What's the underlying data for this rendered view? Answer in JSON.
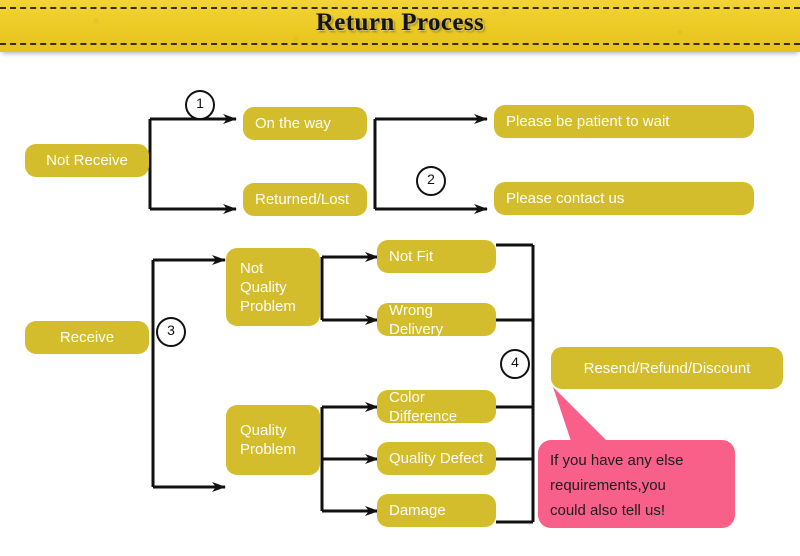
{
  "banner": {
    "title": "Return Process",
    "background_color": "#efd02b",
    "dash_color": "#3a2c07"
  },
  "theme": {
    "node_color": "#d4bd2c",
    "node_text_color": "#fdfdf6",
    "line_color": "#111111",
    "callout_color": "#f85f89",
    "callout_text_color": "#1d1d1d"
  },
  "diagram": {
    "nodes": {
      "not_receive": "Not Receive",
      "on_the_way": "On the way",
      "returned_lost": "Returned/Lost",
      "please_be_patient": "Please be patient to wait",
      "please_contact_us": "Please contact us",
      "receive": "Receive",
      "not_quality_problem": "Not\nQuality\nProblem",
      "quality_problem": "Quality\nProblem",
      "not_fit": "Not Fit",
      "wrong_delivery": "Wrong Delivery",
      "color_difference": "Color Difference",
      "quality_defect": "Quality Defect",
      "damage": "Damage",
      "resend_refund_discount": "Resend/Refund/Discount"
    },
    "badges": {
      "step1": "1",
      "step2": "2",
      "step3": "3",
      "step4": "4"
    }
  },
  "callout": {
    "text": "If you have any else\nrequirements,you\ncould also tell us!"
  }
}
